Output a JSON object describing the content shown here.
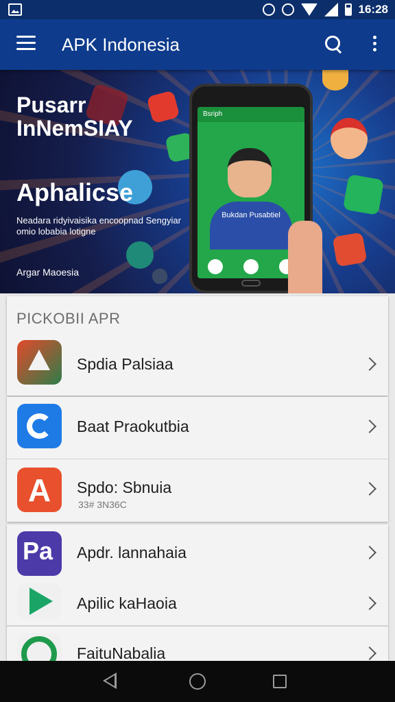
{
  "status_bar": {
    "time": "16:28"
  },
  "app_bar": {
    "title": "APK Indonesia"
  },
  "banner": {
    "headline": "Pusarr\nInNemSIAY",
    "subheadline": "Aphalicse",
    "description": "Neadara ridyivaisika encoopnad Sengyiar omio lobabia lotigne",
    "footer": "Argar Maoesia",
    "phone": {
      "top_label": "Bsriph",
      "name_label": "Bukdan Pusabtiel"
    }
  },
  "list": {
    "section_title": "PICKOBII APR",
    "items": [
      {
        "label": "Spdia Palsiaa",
        "subtitle": "",
        "icon": "red-green-triangle-icon"
      },
      {
        "label": "Baat Praokutbia",
        "subtitle": "",
        "icon": "blue-c-icon"
      },
      {
        "label": "Spdo: Sbnuia",
        "subtitle": "33# 3N36C",
        "icon": "orange-a-icon"
      },
      {
        "label": "Apdr. lannahaia",
        "subtitle": "",
        "icon": "purple-pa-icon"
      },
      {
        "label": "Apilic kaHaoia",
        "subtitle": "",
        "icon": "play-store-icon"
      },
      {
        "label": "FaituNabalia",
        "subtitle": "",
        "icon": "green-swirl-icon"
      }
    ]
  },
  "colors": {
    "status_bar": "#0c2f6b",
    "app_bar": "#0e3b8c",
    "nav_bar": "#0b0b0b"
  }
}
